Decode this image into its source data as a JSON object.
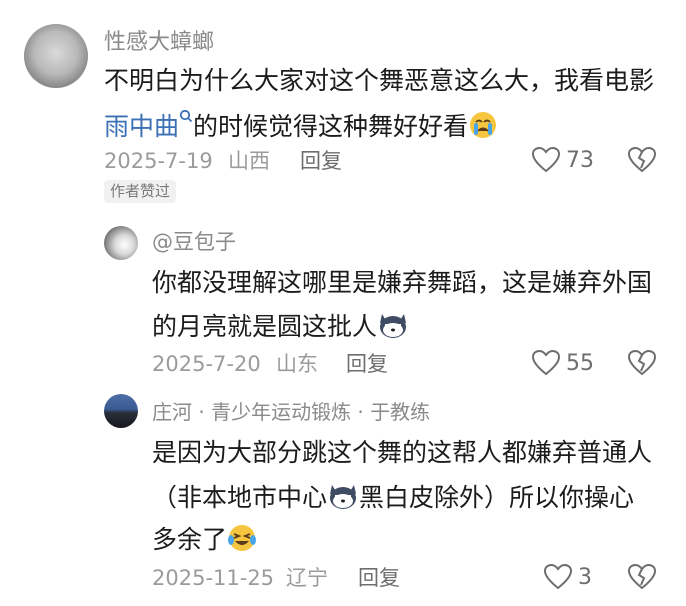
{
  "comments": [
    {
      "username": "性感大蟑螂",
      "line1": "不明白为什么大家对这个舞恶意这么大，我看电影",
      "link_text": "雨中曲",
      "line2_after": "的时候觉得这种舞好好看",
      "date": "2025-7-19",
      "location": "山西",
      "reply_label": "回复",
      "likes": "73",
      "badge": "作者赞过"
    },
    {
      "username": "@豆包子",
      "line1": "你都没理解这哪里是嫌弃舞蹈，这是嫌弃外国",
      "line2": "的月亮就是圆这批人",
      "date": "2025-7-20",
      "location": "山东",
      "reply_label": "回复",
      "likes": "55"
    },
    {
      "username": "庄河 · 青少年运动锻炼 · 于教练",
      "line1": "是因为大部分跳这个舞的这帮人都嫌弃普通人",
      "line2_before": "（非本地市中心",
      "line2_after": "黑白皮除外）所以你操心",
      "line3": "多余了",
      "date": "2025-11-25",
      "location": "辽宁",
      "reply_label": "回复",
      "likes": "3"
    }
  ],
  "icons": {
    "search": "search-icon",
    "heart": "heart-icon",
    "dislike": "broken-heart-icon",
    "cry": "crying-emoji",
    "husky": "husky-emoji",
    "laugh": "laugh-cry-emoji"
  },
  "colors": {
    "link": "#3b6fb6",
    "meta": "#9b9b9b",
    "text": "#1c1c1c"
  }
}
